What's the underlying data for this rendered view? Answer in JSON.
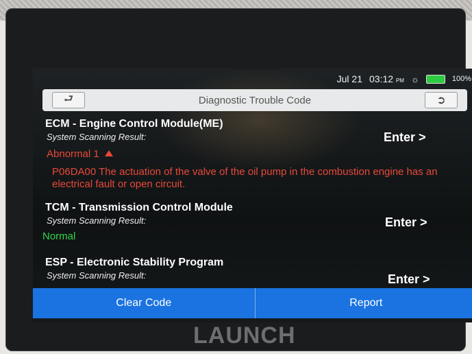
{
  "status": {
    "date": "Jul 21",
    "time": "03:12",
    "ampm": "PM",
    "battery": "100%",
    "icons": [
      "wifi-icon",
      "battery-icon"
    ]
  },
  "header": {
    "title": "Diagnostic Trouble Code",
    "back_icon": "back-arrow-icon",
    "exit_icon": "exit-icon"
  },
  "modules": [
    {
      "title": "ECM - Engine Control Module(ME)",
      "scan_label": "System Scanning Result:",
      "result": "Abnormal 1",
      "enter": "Enter >",
      "dtc": "P06DA00 The actuation of the valve of the oil pump in the combustion engine has an electrical fault or open circuit."
    },
    {
      "title": "TCM - Transmission Control Module",
      "scan_label": "System Scanning Result:",
      "result": "Normal",
      "enter": "Enter >"
    },
    {
      "title": "ESP - Electronic Stability Program",
      "scan_label": "System Scanning Result:",
      "enter": "Enter >"
    }
  ],
  "actions": {
    "clear": "Clear Code",
    "report": "Report"
  },
  "brand": "LAUNCH",
  "colors": {
    "accent": "#1a73e0",
    "abnormal": "#e8483a",
    "normal": "#2fd44a"
  }
}
